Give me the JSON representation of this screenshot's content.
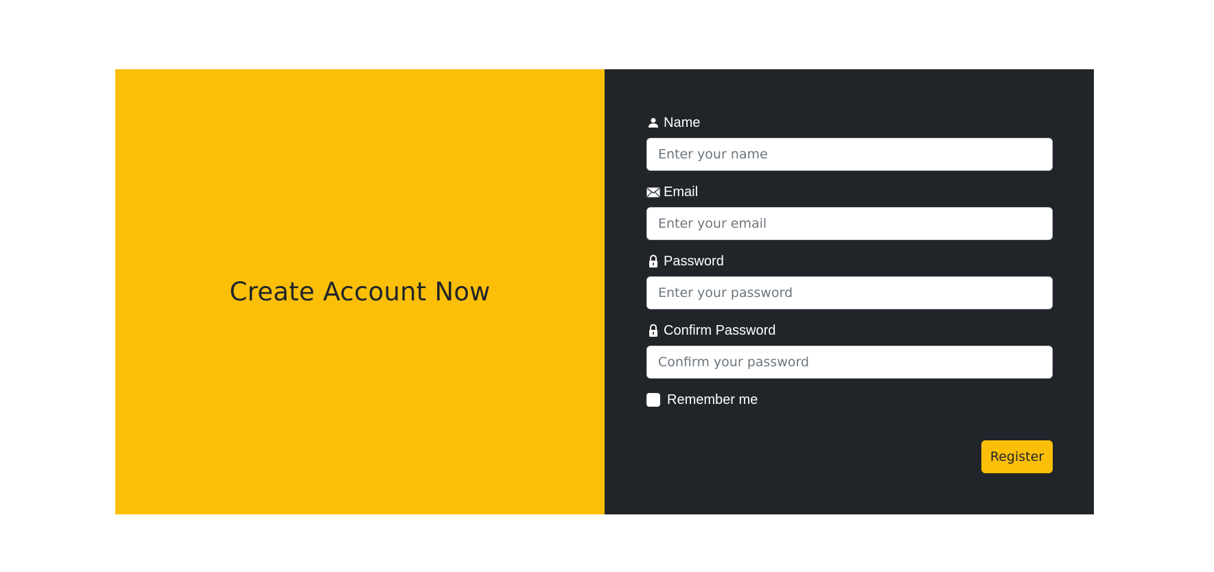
{
  "hero": {
    "title": "Create Account Now"
  },
  "form": {
    "fields": [
      {
        "label": "Name",
        "placeholder": "Enter your name",
        "value": "",
        "icon": "user-icon"
      },
      {
        "label": "Email",
        "placeholder": "Enter your email",
        "value": "",
        "icon": "envelope-icon"
      },
      {
        "label": "Password",
        "placeholder": "Enter your password",
        "value": "",
        "icon": "lock-icon"
      },
      {
        "label": "Confirm Password",
        "placeholder": "Confirm your password",
        "value": "",
        "icon": "lock-icon"
      }
    ],
    "remember_label": "Remember me",
    "remember_checked": false,
    "submit_label": "Register"
  },
  "colors": {
    "accent": "#fcbf08",
    "dark_panel": "#212529",
    "text_dark": "#212529",
    "text_light": "#ffffff"
  }
}
